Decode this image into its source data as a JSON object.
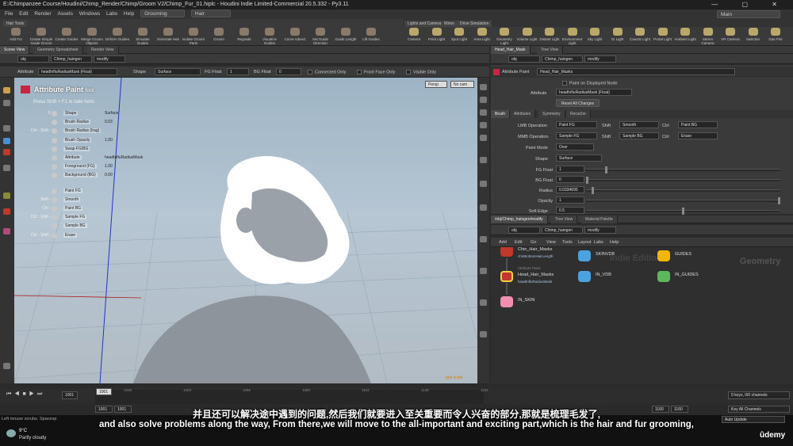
{
  "window": {
    "title": "E:/Chimpanzee Course/Houdini/Chimp_Render/Chimp/Groom V2/Chimp_Fur_01.hiplc - Houdini Indie Limited-Commercial 20.5.332 - Py3.11",
    "controls": "—  ▢  ✕"
  },
  "menu": {
    "items": [
      "File",
      "Edit",
      "Render",
      "Assets",
      "Windows",
      "Labs",
      "Help"
    ],
    "desktop": "Grooming",
    "context": "Hair",
    "main": "Main"
  },
  "shelf": {
    "tab": "Hair Tools",
    "tools": [
      "Add Fur",
      "Create Simple Guide Groom",
      "Create Guides",
      "Merge Groom Objects",
      "Deform Guides",
      "Simulate Guides",
      "Generate Hair",
      "Isolate Groom Parts",
      "Groom",
      "Regrade",
      "Visualize Guides",
      "Curve Advect",
      "Set Guide Direction",
      "Guide Length",
      "Lift Guides"
    ],
    "right_tabs": [
      "Lights and Cameras",
      "Wires",
      "Drive Simulation"
    ],
    "right_tools": [
      "Camera",
      "Point Light",
      "Spot Light",
      "Area Light",
      "Geometry Light",
      "Volume Light",
      "Distant Light",
      "Environment Light",
      "Sky Light",
      "GI Light",
      "Caustic Light",
      "Portal Light",
      "Ambient Light",
      "Stereo Camera",
      "VR Camera",
      "Switcher",
      "Gas Fire"
    ]
  },
  "left_pane": {
    "tabs": [
      "Scene View",
      "Geometry Spreadsheet",
      "Render View"
    ],
    "path": [
      "obj",
      "Chimp_haingen",
      "modify"
    ],
    "attribute_label": "Attribute",
    "attribute_value": "headInfluRadiusMask (Float)",
    "shape_label": "Shape",
    "shape_value": "Surface",
    "fg_label": "FG Float",
    "fg_value": "1",
    "bg_label": "BG Float",
    "bg_value": "0",
    "connected_only": "Connected Only",
    "front_face_only": "Front Face Only",
    "visible_only": "Visible Only"
  },
  "viewport": {
    "tool_title": "Attribute Paint",
    "tool_suffix": "tool",
    "hint": "Press Shift + F1 to hide hints",
    "persp": "Persp",
    "cam": "No cam",
    "hints": [
      {
        "key": "S",
        "label": "Shape",
        "value": "Surface"
      },
      {
        "key": "",
        "label": "Brush Radius",
        "value": "0.03"
      },
      {
        "key": "Ctrl - Shift -",
        "label": "Brush Radius (frag)",
        "value": ""
      },
      {
        "key": "",
        "label": "Brush Opacity",
        "value": "1.00"
      },
      {
        "key": "",
        "label": "Swap FG/BG",
        "value": ""
      },
      {
        "key": "",
        "label": "Attribute",
        "value": "headInfluRadiusMask"
      },
      {
        "key": "",
        "label": "Foreground (FG)",
        "value": "1.00"
      },
      {
        "key": "",
        "label": "Background (BG)",
        "value": "0.00"
      },
      {
        "key": "",
        "label": "Paint FG",
        "value": ""
      },
      {
        "key": "Shift -",
        "label": "Smooth",
        "value": ""
      },
      {
        "key": "Ctrl -",
        "label": "Paint BG",
        "value": ""
      },
      {
        "key": "Ctrl - Shift -",
        "label": "Sample FG",
        "value": ""
      },
      {
        "key": "",
        "label": "Sample BG",
        "value": ""
      },
      {
        "key": "Ctrl - Shift -",
        "label": "Erase",
        "value": ""
      }
    ],
    "footer_label": "grid scale"
  },
  "params": {
    "tabs": [
      "Head_Hair_Mask",
      "Tree View",
      "Material Palette"
    ],
    "path": [
      "obj",
      "Chimp_haingen",
      "modify"
    ],
    "node_type": "Attribute Paint",
    "node_name": "Head_Hair_Masks",
    "paint_on_displayed": "Paint on Displayed Node",
    "attribute_label": "Attribute",
    "attribute_value": "headInfluRadiusMask (Float)",
    "reset_button": "Reset All Changes",
    "subtabs": [
      "Brush",
      "Attributes",
      "Symmetry",
      "Recache"
    ],
    "lmb_label": "LMB Operation",
    "lmb_value": "Paint FG",
    "mmb_label": "MMB Operation",
    "mmb_value": "Sample FG",
    "shift_label": "Shift",
    "shift_lmb": "Smooth",
    "shift_mmb": "Sample BG",
    "ctrl_label": "Ctrl",
    "ctrl_lmb": "Paint BG",
    "ctrl_mmb": "Erase",
    "paint_mode_label": "Paint Mode",
    "paint_mode_value": "Over",
    "shape_label": "Shape",
    "shape_value": "Surface",
    "fg_float_label": "FG Float",
    "fg_float_value": "1",
    "fg_float_level": 0.1,
    "bg_float_label": "BG Float",
    "bg_float_value": "0",
    "bg_float_level": 0.0,
    "radius_label": "Radius",
    "radius_value": "0.0334695",
    "radius_level": 0.03,
    "opacity_label": "Opacity",
    "opacity_value": "1",
    "opacity_level": 1.0,
    "soft_edge_label": "Soft Edge",
    "soft_edge_value": "0.5",
    "soft_edge_level": 0.5
  },
  "network": {
    "tabs": [
      "/obj/Chimp_haingen/modify",
      "Tree View",
      "Material Palette"
    ],
    "path": [
      "obj",
      "Chimp_haingen",
      "modify"
    ],
    "menu": [
      "Add",
      "Edit",
      "Go",
      "View",
      "Tools",
      "Layout",
      "Labs",
      "Help"
    ],
    "watermark_left": "Indie Edition",
    "watermark_right": "Geometry",
    "nodes": [
      {
        "name": "Chin_Hair_Masks",
        "sub": "chinBottomHairLength",
        "color": "#c0392b"
      },
      {
        "name": "SKINVDB",
        "sub": "",
        "color": "#4aa3df"
      },
      {
        "name": "GUIDES",
        "sub": "",
        "color": "#f2b705"
      },
      {
        "name": "Head_Hair_Masks",
        "sub": "headInfluRadiusMask",
        "type": "Attribute Paint",
        "color": "#c0392b"
      },
      {
        "name": "IN_VDB",
        "sub": "",
        "color": "#4aa3df"
      },
      {
        "name": "IN_GUIDES",
        "sub": "",
        "color": "#5cb85c"
      },
      {
        "name": "IN_SKIN",
        "sub": "",
        "color": "#f08fb0"
      }
    ]
  },
  "timeline": {
    "frame": "1001",
    "current": "1001",
    "ticks": [
      "1008",
      "1020",
      "1056",
      "1080",
      "1104",
      "1128",
      "1152"
    ],
    "start": "1001",
    "start2": "1001",
    "end": "1160",
    "end2": "1160",
    "keys": "0 keys, 0/0 channels",
    "key_all": "Key All Channels",
    "auto_update": "Auto Update"
  },
  "status": {
    "left": "Left mouse scrubs. Spacesp",
    "weather_temp": "9°C",
    "weather_desc": "Partly cloudy",
    "subtitle_cn": "并且还可以解决途中遇到的问题,然后我们就要进入至关重要而令人兴奋的部分,那就是梳理毛发了,",
    "subtitle_en": "and also solve problems along the way, From there,we will move to the all-important and exciting part,which is the hair and fur grooming,",
    "brand": "ûdemy"
  }
}
